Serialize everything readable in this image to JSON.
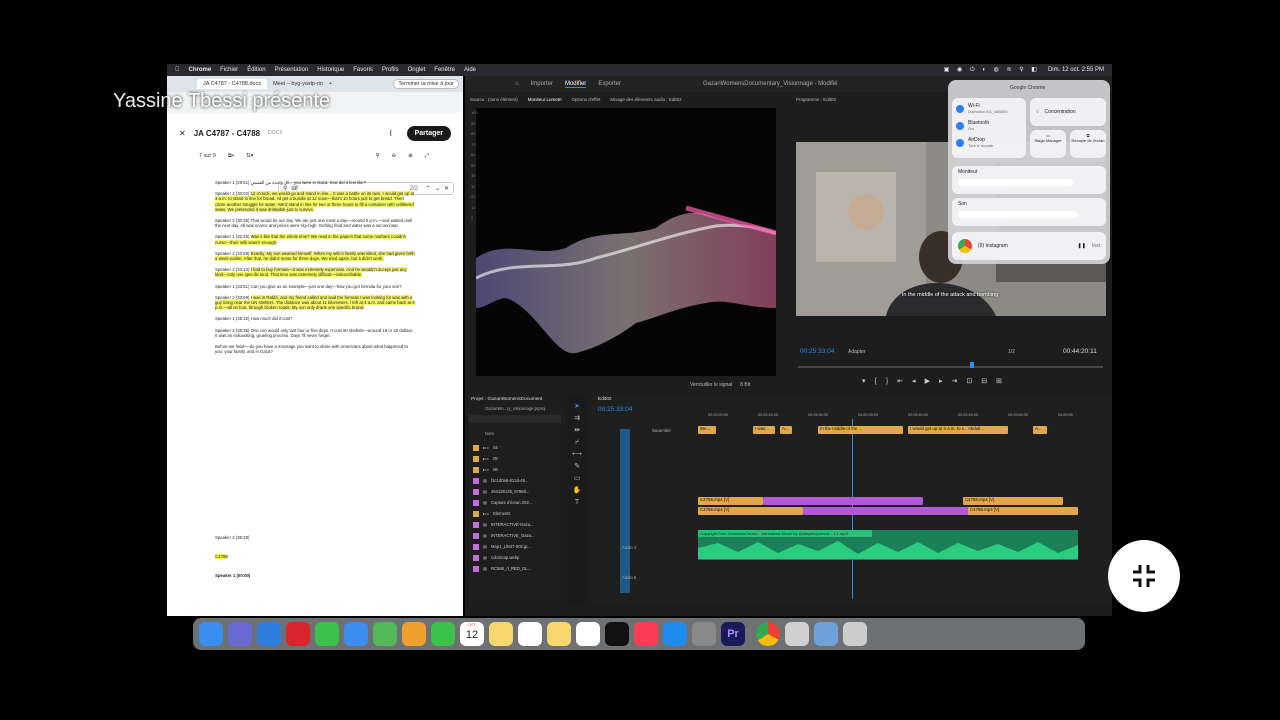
{
  "overlay": {
    "title": "Yassine Tbessi présente"
  },
  "menubar": {
    "apple": "",
    "items": [
      "Chrome",
      "Fichier",
      "Édition",
      "Présentation",
      "Historique",
      "Favoris",
      "Profils",
      "Onglet",
      "Fenêtre",
      "Aide"
    ],
    "clock": "Dim. 12 oct.  2:55 PM"
  },
  "chrome": {
    "tabs": [
      "JA C4787 - C4788.docx",
      "Meet – byg-ywdp-rin"
    ],
    "update_button": "Terminer la mise à jour",
    "doc_title": "JA C4787 - C4788",
    "doc_type": "DOCX",
    "share": "Partager",
    "pager": "7 sur 9",
    "find": {
      "query": "dif",
      "count": "2/2"
    }
  },
  "doc": {
    "paragraphs": [
      {
        "speaker": "Speaker 1 (29:51)",
        "text": "كل واحدة من القصص... you were in Gaza: how did it feel like?",
        "highlight": false
      },
      {
        "speaker": "Speaker 2 (30:02)",
        "text": "12 o'clock, we would go and stand in line... It was a battle on its own. I would get up at 3 a.m. to stand in line for bread. I'd get a bundle at 12 noon—that's 10 hours just to get bread. Then came another struggle for water. We'd stand in line for two or three hours to fill a container with unfiltered water. We pretended it was drinkable just to survive.",
        "highlight": true
      },
      {
        "speaker": "Speaker 2 (30:36)",
        "text": "That would be our day. We ate just one meal a day—around 5 p.m.—and waited until the next day. All was scarce and prices were sky-high. Getting food and water was a second war.",
        "highlight": false
      },
      {
        "speaker": "Speaker 1 (32:26)",
        "text": "Was it like that the whole time? We read in the papers that some mothers couldn't nurse—their milk wasn't enough.",
        "highlight": true
      },
      {
        "speaker": "Speaker 2 (32:58)",
        "text": "Exactly. My son weaned himself. When my wife's family was killed, she had given birth a week earlier. After that, he didn't nurse for three days. We tried again, but it didn't work.",
        "highlight": true
      },
      {
        "speaker": "Speaker 2 (33:14)",
        "text": "I had to buy formula—it was extremely expensive. And he wouldn't accept just any kind—only one specific kind. That time was extremely difficult—indescribable.",
        "highlight": true
      },
      {
        "speaker": "Speaker 1 (33:51)",
        "text": "Can you give us an example—just one day—how you got formula for your son?",
        "highlight": false
      },
      {
        "speaker": "Speaker 2 (33:59)",
        "text": "I was in Rafah, and my friend called and said the formula I was looking for was with a guy living near the UN shelters. The distance was about 11 kilometers. I left at 4 a.m. and came back at 8 p.m.—all on foot, through broken roads. My son only drank one specific brand.",
        "highlight": true
      },
      {
        "speaker": "Speaker 1 (35:32)",
        "text": "How much did it cost?",
        "highlight": false
      },
      {
        "speaker": "Speaker 2 (35:35)",
        "text": "One can would only last four or five days. It cost 90 shekels—around 18 or 20 dollars. It was an exhausting, grueling process. Days I'll never forget.",
        "highlight": false
      },
      {
        "speaker": "",
        "text": "Before we finish—do you have a message you want to share with Americans about what happened to you, your family, and in Gaza?",
        "highlight": false
      }
    ],
    "page2": [
      "Speaker 2 (36:29)",
      "C4788",
      "Speaker 1 (00:00)"
    ]
  },
  "premiere": {
    "top_tabs": [
      "Importer",
      "Modifier",
      "Exporter"
    ],
    "project_title": "GazanWomensDocumentary_Visionnage - Modifié",
    "source_tabs": [
      "Source : (sans élément)",
      "Moniteur Lumetri",
      "Options d'effet",
      "Mixage des éléments audio : Edit02"
    ],
    "program_label": "Programme : Edit02",
    "program_tc": "00:25:33:04",
    "program_fit": "Adapter",
    "program_ratio": "1/2",
    "program_duration": "00:44:20:11",
    "subtitle": "In the middle of the attack and bombing",
    "scope_footer": "Verrouiller le signal",
    "scope_bits": "8 Bit",
    "project_panel": "Projet : GazanWomensDocument",
    "project_file": "GazanWo...ry_Visionnage.prproj",
    "bins_header": "Nom",
    "bins": [
      "04",
      "05",
      "06",
      "f3c1d0a8-612d-48...",
      "494126135_97968...",
      "Capture d'écran 202...",
      "Elements",
      "INTERACTIVE-Gaza...",
      "INTERACTIVE_Gaza...",
      "Map1_UN47-002.jp...",
      "colormap.webp",
      "RC588_rl_RED_DL..."
    ],
    "timeline_tab": "Edit02",
    "timeline_tc": "00:25:33:04",
    "ruler": [
      "00:25:20:00",
      "00:25:25:00",
      "00:25:30:00",
      "00:25:35:00",
      "00:25:40:00",
      "00:25:45:00",
      "00:25:50:00",
      "00:25:55"
    ],
    "subtitle_track": "Sous-titre",
    "subtitle_clips": [
      "We...",
      "I was...",
      "A...",
      "In the middle of the ...",
      "I would get up at 3 a.m. to s...",
      "Abdull...",
      "A..."
    ],
    "video_clips": [
      "C4796.mp4 [V]",
      "C4795.mp4 [V]"
    ],
    "audio_clip": "Copyright Free Orchestral Music - Unrealized Shore by @AlkyrieUpbrook - 1 1.mp3",
    "audio_tracks": [
      "Audio 4",
      "Audio 5"
    ]
  },
  "control_center": {
    "header": "Google Chrome",
    "wifi": {
      "label": "Wi-Fi",
      "sub": "Domotion 5G_36B000"
    },
    "bluetooth": {
      "label": "Bluetooth",
      "sub": "Oui"
    },
    "airdrop": {
      "label": "AirDrop",
      "sub": "Tout le monde"
    },
    "focus": "Concentration",
    "stage": "Stage Manager",
    "mirror": "Recopie de l'écran",
    "display": "Moniteur",
    "sound": "Son",
    "now_playing": "(9) Instagram",
    "now_playing_sub": "Inst"
  },
  "dock": {
    "calendar_month": "OCT.",
    "calendar_day": "12",
    "apps": [
      "finder",
      "launchpad",
      "safari",
      "opera",
      "messages",
      "mail",
      "maps",
      "photos",
      "facetime",
      "calendar",
      "notes",
      "reminders",
      "notes-yellow",
      "freeform",
      "apple-tv",
      "music",
      "app-store",
      "settings",
      "premiere",
      "chrome",
      "preview",
      "finder2",
      "trash"
    ]
  },
  "colors": {
    "accent": "#2d8ceb",
    "highlight": "#f5f56a",
    "video_clip": "#e0a84b",
    "audio_clip": "#27c27a",
    "purple_clip": "#b05ad8"
  }
}
